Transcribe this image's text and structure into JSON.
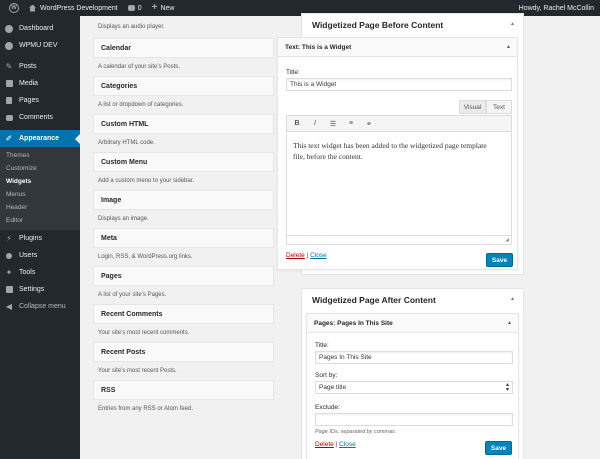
{
  "adminbar": {
    "site_name": "WordPress Development",
    "comments_count": "0",
    "new_label": "New",
    "howdy": "Howdy, Rachel McCollin"
  },
  "sidebar": {
    "items": [
      {
        "label": "Dashboard",
        "icon": "gauge-icon"
      },
      {
        "label": "WPMU DEV",
        "icon": "wpmudev-icon"
      },
      {
        "label": "Posts",
        "icon": "pin-icon"
      },
      {
        "label": "Media",
        "icon": "media-icon"
      },
      {
        "label": "Pages",
        "icon": "page-icon"
      },
      {
        "label": "Comments",
        "icon": "comment-icon"
      },
      {
        "label": "Appearance",
        "icon": "brush-icon"
      },
      {
        "label": "Plugins",
        "icon": "plug-icon"
      },
      {
        "label": "Users",
        "icon": "user-icon"
      },
      {
        "label": "Tools",
        "icon": "wrench-icon"
      },
      {
        "label": "Settings",
        "icon": "settings-icon"
      },
      {
        "label": "Collapse menu",
        "icon": "collapse-icon"
      }
    ],
    "submenu": [
      "Themes",
      "Customize",
      "Widgets",
      "Menus",
      "Header",
      "Editor"
    ]
  },
  "available_widgets": {
    "first_description": "Displays an audio player.",
    "items": [
      {
        "title": "Calendar",
        "description": "A calendar of your site’s Posts."
      },
      {
        "title": "Categories",
        "description": "A list or dropdown of categories."
      },
      {
        "title": "Custom HTML",
        "description": "Arbitrary HTML code."
      },
      {
        "title": "Custom Menu",
        "description": "Add a custom menu to your sidebar."
      },
      {
        "title": "Image",
        "description": "Displays an image."
      },
      {
        "title": "Meta",
        "description": "Login, RSS, & WordPress.org links."
      },
      {
        "title": "Pages",
        "description": "A list of your site’s Pages."
      },
      {
        "title": "Recent Comments",
        "description": "Your site’s most recent comments."
      },
      {
        "title": "Recent Posts",
        "description": "Your site’s most recent Posts."
      },
      {
        "title": "RSS",
        "description": "Entries from any RSS or Atom feed."
      }
    ]
  },
  "area_before": {
    "title": "Widgetized Page Before Content",
    "widget": {
      "header": "Text: This is a Widget",
      "title_label": "Title:",
      "title_value": "This is a Widget",
      "tab_visual": "Visual",
      "tab_text": "Text",
      "toolbar": [
        "B",
        "I",
        "ul",
        "ol",
        "link"
      ],
      "content": "This text widget has been added to the widgetized page template file, before the content.",
      "delete": "Delete",
      "separator": "|",
      "close": "Close",
      "save": "Save"
    }
  },
  "area_after": {
    "title": "Widgetized Page After Content",
    "widget": {
      "header": "Pages: Pages In This Site",
      "title_label": "Title:",
      "title_value": "Pages In This Site",
      "sort_label": "Sort by:",
      "sort_value": "Page title",
      "exclude_label": "Exclude:",
      "exclude_value": "",
      "exclude_hint": "Page IDs, separated by commas.",
      "delete": "Delete",
      "separator": "|",
      "close": "Close",
      "save": "Save"
    }
  }
}
